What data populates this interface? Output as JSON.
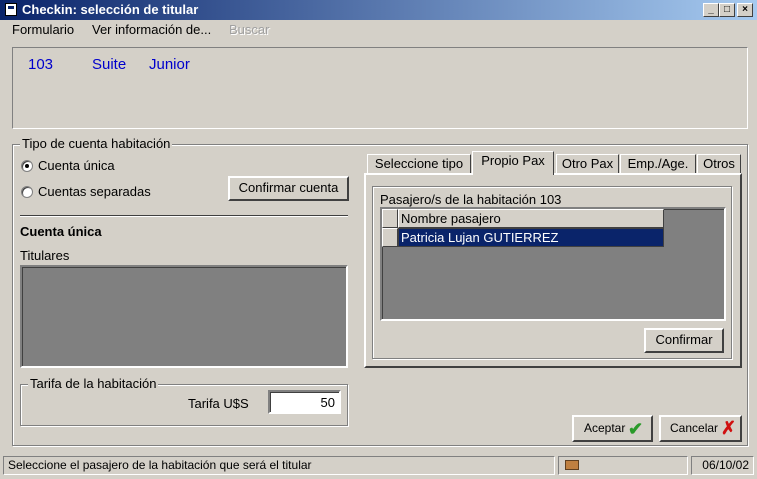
{
  "window": {
    "title": "Checkin: selección de titular",
    "controls": [
      "minimize",
      "maximize",
      "close"
    ]
  },
  "menu": {
    "items": [
      {
        "label": "Formulario",
        "enabled": true
      },
      {
        "label": "Ver información de...",
        "enabled": true
      },
      {
        "label": "Buscar",
        "enabled": false
      }
    ]
  },
  "room": {
    "number": "103",
    "type": "Suite",
    "category": "Junior"
  },
  "account": {
    "group_label": "Tipo de cuenta habitación",
    "options": [
      {
        "label": "Cuenta única",
        "selected": true
      },
      {
        "label": "Cuentas separadas",
        "selected": false
      }
    ],
    "confirm_button": "Confirmar cuenta",
    "section_title": "Cuenta única",
    "holders_label": "Titulares"
  },
  "rate": {
    "group_label": "Tarifa de la habitación",
    "field_label": "Tarifa U$S",
    "value": "50"
  },
  "tabs": {
    "items": [
      "Seleccione tipo",
      "Propio Pax",
      "Otro Pax",
      "Emp./Age.",
      "Otros"
    ],
    "active": "Propio Pax"
  },
  "passengers": {
    "label": "Pasajero/s de la habitación 103",
    "column_header": "Nombre pasajero",
    "rows": [
      "Patricia Lujan  GUTIERREZ"
    ],
    "confirm_button": "Confirmar"
  },
  "actions": {
    "accept": "Aceptar",
    "cancel": "Cancelar"
  },
  "status": {
    "message": "Seleccione el pasajero de la habitación que será el titular",
    "date": "06/10/02"
  },
  "colors": {
    "titlebar": "#0a246a",
    "selection": "#0a246a",
    "room_text": "#0000cc",
    "list_bg": "#808080"
  }
}
